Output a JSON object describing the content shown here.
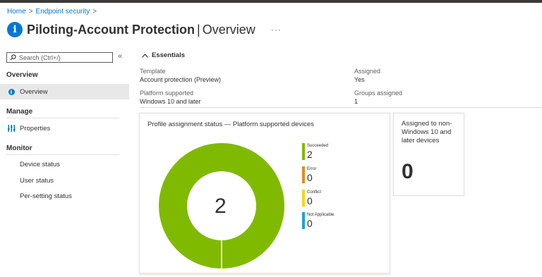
{
  "breadcrumb": [
    "Home",
    "Endpoint security"
  ],
  "page": {
    "title_main": "Piloting-Account Protection",
    "title_separator": "|",
    "title_sub": "Overview",
    "more_label": "···"
  },
  "sidebar": {
    "search_placeholder": "Search (Ctrl+/)",
    "collapse_label": "«",
    "sections": [
      {
        "heading": "Overview",
        "items": [
          {
            "label": "Overview",
            "icon": "info-icon",
            "active": true
          }
        ]
      },
      {
        "heading": "Manage",
        "items": [
          {
            "label": "Properties",
            "icon": "properties-icon"
          }
        ]
      },
      {
        "heading": "Monitor",
        "items": [
          {
            "label": "Device status"
          },
          {
            "label": "User status"
          },
          {
            "label": "Per-setting status"
          }
        ]
      }
    ]
  },
  "essentials": {
    "toggle_label": "Essentials",
    "fields": {
      "template": {
        "label": "Template",
        "value": "Account protection (Preview)"
      },
      "assigned": {
        "label": "Assigned",
        "value": "Yes"
      },
      "platform": {
        "label": "Platform supported",
        "value": "Windows 10 and later"
      },
      "groups": {
        "label": "Groups assigned",
        "value": "1"
      }
    }
  },
  "status_card": {
    "title": "Profile assignment status — Platform supported devices",
    "total": "2",
    "legend": [
      {
        "name": "Succeeded",
        "value": "2",
        "color": "#7fba00"
      },
      {
        "name": "Error",
        "value": "0",
        "color": "#e8891b"
      },
      {
        "name": "Conflict",
        "value": "0",
        "color": "#fcd116"
      },
      {
        "name": "Not Applicable",
        "value": "0",
        "color": "#1ba1e2"
      }
    ]
  },
  "chart_data": {
    "type": "pie",
    "title": "Profile assignment status — Platform supported devices",
    "categories": [
      "Succeeded",
      "Error",
      "Conflict",
      "Not Applicable"
    ],
    "values": [
      2,
      0,
      0,
      0
    ],
    "colors": [
      "#7fba00",
      "#e8891b",
      "#fcd116",
      "#1ba1e2"
    ],
    "legend_position": "right"
  },
  "nonwin_card": {
    "title": "Assigned to non-Windows 10 and later devices",
    "value": "0"
  },
  "colors": {
    "accent": "#0078d4",
    "succeeded": "#7fba00"
  }
}
